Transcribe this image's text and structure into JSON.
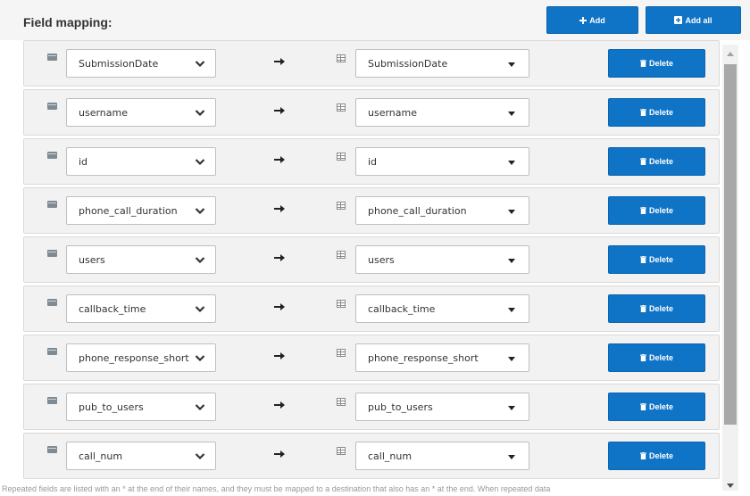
{
  "header": {
    "title": "Field mapping:",
    "add_label": "Add",
    "add_all_label": "Add all"
  },
  "mappings": [
    {
      "source": "SubmissionDate",
      "destination": "SubmissionDate",
      "delete_label": "Delete"
    },
    {
      "source": "username",
      "destination": "username",
      "delete_label": "Delete"
    },
    {
      "source": "id",
      "destination": "id",
      "delete_label": "Delete"
    },
    {
      "source": "phone_call_duration",
      "destination": "phone_call_duration",
      "delete_label": "Delete"
    },
    {
      "source": "users",
      "destination": "users",
      "delete_label": "Delete"
    },
    {
      "source": "callback_time",
      "destination": "callback_time",
      "delete_label": "Delete"
    },
    {
      "source": "phone_response_short",
      "destination": "phone_response_short",
      "delete_label": "Delete"
    },
    {
      "source": "pub_to_users",
      "destination": "pub_to_users",
      "delete_label": "Delete"
    },
    {
      "source": "call_num",
      "destination": "call_num",
      "delete_label": "Delete"
    }
  ],
  "footnote": "Repeated fields are listed with an * at the end of their names, and they must be mapped to a destination that also has an * at the end. When repeated data",
  "colors": {
    "primary": "#0f73c6",
    "row_bg": "#f2f2f2",
    "header_bg": "#f5f5f5"
  },
  "icons": {
    "add": "plus-icon",
    "add_all": "plus-square-icon",
    "delete": "trash-icon",
    "arrow": "arrow-right-icon",
    "source": "field-icon",
    "destination": "table-icon"
  }
}
